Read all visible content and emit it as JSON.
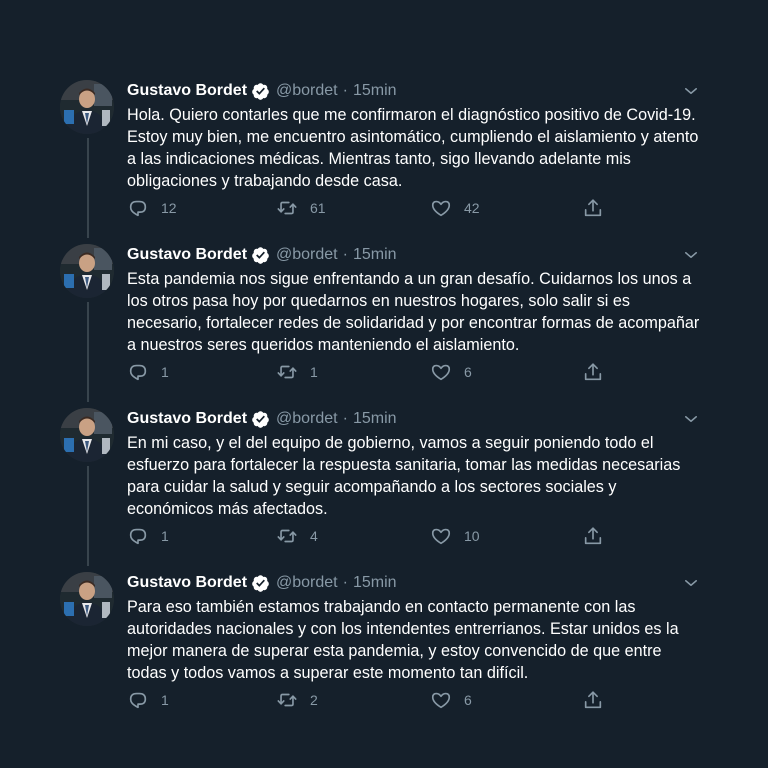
{
  "tweets": [
    {
      "author": "Gustavo Bordet",
      "handle": "@bordet",
      "separator": "·",
      "time": "15min",
      "text": "Hola. Quiero contarles que me confirmaron el diagnóstico positivo de Covid-19. Estoy muy bien, me encuentro asintomático, cumpliendo el aislamiento y atento a las indicaciones médicas. Mientras tanto, sigo llevando adelante mis obligaciones y trabajando desde casa.",
      "replies": "12",
      "retweets": "61",
      "likes": "42"
    },
    {
      "author": "Gustavo Bordet",
      "handle": "@bordet",
      "separator": "·",
      "time": "15min",
      "text": "Esta pandemia nos sigue enfrentando a un gran desafío. Cuidarnos los unos a los otros pasa hoy por quedarnos en nuestros hogares, solo salir si es necesario, fortalecer redes de solidaridad y por encontrar formas de acompañar a nuestros seres queridos manteniendo el aislamiento.",
      "replies": "1",
      "retweets": "1",
      "likes": "6"
    },
    {
      "author": "Gustavo Bordet",
      "handle": "@bordet",
      "separator": "·",
      "time": "15min",
      "text": "En mi caso, y el del equipo de gobierno, vamos a seguir poniendo todo el esfuerzo para fortalecer la respuesta sanitaria, tomar las medidas necesarias para cuidar la salud y seguir acompañando a los sectores sociales y económicos más afectados.",
      "replies": "1",
      "retweets": "4",
      "likes": "10"
    },
    {
      "author": "Gustavo Bordet",
      "handle": "@bordet",
      "separator": "·",
      "time": "15min",
      "text": "Para eso también estamos trabajando en contacto permanente con las autoridades nacionales y con los intendentes entrerrianos. Estar unidos es la mejor manera de superar esta pandemia, y estoy convencido de que entre todas y todos vamos a superar este momento tan difícil.",
      "replies": "1",
      "retweets": "2",
      "likes": "6"
    }
  ],
  "icons": {
    "verified": "verified-badge-icon",
    "caret": "chevron-down-icon",
    "reply": "reply-icon",
    "retweet": "retweet-icon",
    "like": "heart-icon",
    "share": "share-icon"
  },
  "colors": {
    "background": "#15202b",
    "text": "#ffffff",
    "secondary": "#8899a6",
    "thread_line": "#38444d"
  }
}
